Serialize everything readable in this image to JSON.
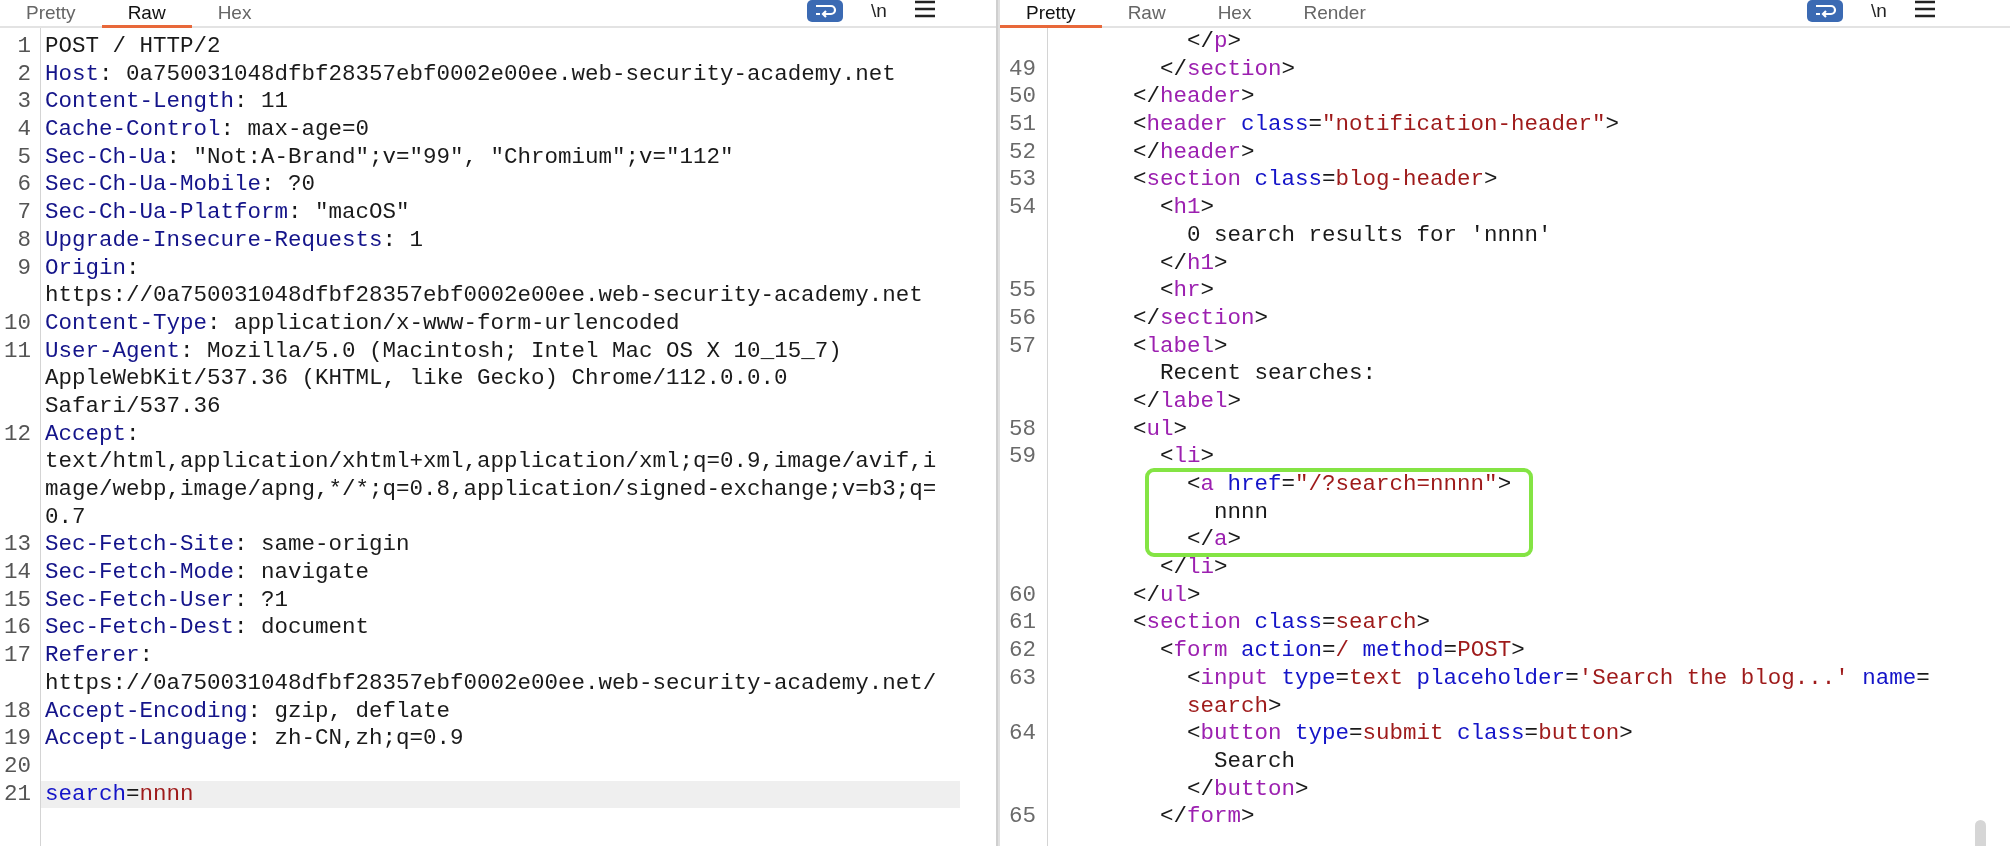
{
  "request_panel": {
    "tabs": [
      {
        "label": "Pretty",
        "selected": false
      },
      {
        "label": "Raw",
        "selected": true
      },
      {
        "label": "Hex",
        "selected": false
      }
    ],
    "newline_toggle": "\\n",
    "rows": [
      {
        "number": "1",
        "current": false,
        "tokens": [
          {
            "kind": "plain",
            "text": "POST / HTTP/2"
          }
        ]
      },
      {
        "number": "2",
        "current": false,
        "tokens": [
          {
            "kind": "name",
            "text": "Host"
          },
          {
            "kind": "plain",
            "text": ": 0a750031048dfbf28357ebf0002e00ee.web-security-academy.net"
          }
        ]
      },
      {
        "number": "3",
        "current": false,
        "tokens": [
          {
            "kind": "name",
            "text": "Content-Length"
          },
          {
            "kind": "plain",
            "text": ": 11"
          }
        ]
      },
      {
        "number": "4",
        "current": false,
        "tokens": [
          {
            "kind": "name",
            "text": "Cache-Control"
          },
          {
            "kind": "plain",
            "text": ": max-age=0"
          }
        ]
      },
      {
        "number": "5",
        "current": false,
        "tokens": [
          {
            "kind": "name",
            "text": "Sec-Ch-Ua"
          },
          {
            "kind": "plain",
            "text": ": \"Not:A-Brand\";v=\"99\", \"Chromium\";v=\"112\""
          }
        ]
      },
      {
        "number": "6",
        "current": false,
        "tokens": [
          {
            "kind": "name",
            "text": "Sec-Ch-Ua-Mobile"
          },
          {
            "kind": "plain",
            "text": ": ?0"
          }
        ]
      },
      {
        "number": "7",
        "current": false,
        "tokens": [
          {
            "kind": "name",
            "text": "Sec-Ch-Ua-Platform"
          },
          {
            "kind": "plain",
            "text": ": \"macOS\""
          }
        ]
      },
      {
        "number": "8",
        "current": false,
        "tokens": [
          {
            "kind": "name",
            "text": "Upgrade-Insecure-Requests"
          },
          {
            "kind": "plain",
            "text": ": 1"
          }
        ]
      },
      {
        "number": "9",
        "current": false,
        "tokens": [
          {
            "kind": "name",
            "text": "Origin"
          },
          {
            "kind": "plain",
            "text": ":"
          }
        ]
      },
      {
        "current": false,
        "tokens": [
          {
            "kind": "plain",
            "text": "https://0a750031048dfbf28357ebf0002e00ee.web-security-academy.net"
          }
        ]
      },
      {
        "number": "10",
        "current": false,
        "tokens": [
          {
            "kind": "name",
            "text": "Content-Type"
          },
          {
            "kind": "plain",
            "text": ": application/x-www-form-urlencoded"
          }
        ]
      },
      {
        "number": "11",
        "current": false,
        "tokens": [
          {
            "kind": "name",
            "text": "User-Agent"
          },
          {
            "kind": "plain",
            "text": ": Mozilla/5.0 (Macintosh; Intel Mac OS X 10_15_7)"
          }
        ]
      },
      {
        "current": false,
        "tokens": [
          {
            "kind": "plain",
            "text": "AppleWebKit/537.36 (KHTML, like Gecko) Chrome/112.0.0.0"
          }
        ]
      },
      {
        "current": false,
        "tokens": [
          {
            "kind": "plain",
            "text": "Safari/537.36"
          }
        ]
      },
      {
        "number": "12",
        "current": false,
        "tokens": [
          {
            "kind": "name",
            "text": "Accept"
          },
          {
            "kind": "plain",
            "text": ":"
          }
        ]
      },
      {
        "current": false,
        "tokens": [
          {
            "kind": "plain",
            "text": "text/html,application/xhtml+xml,application/xml;q=0.9,image/avif,i"
          }
        ]
      },
      {
        "current": false,
        "tokens": [
          {
            "kind": "plain",
            "text": "mage/webp,image/apng,*/*;q=0.8,application/signed-exchange;v=b3;q="
          }
        ]
      },
      {
        "current": false,
        "tokens": [
          {
            "kind": "plain",
            "text": "0.7"
          }
        ]
      },
      {
        "number": "13",
        "current": false,
        "tokens": [
          {
            "kind": "name",
            "text": "Sec-Fetch-Site"
          },
          {
            "kind": "plain",
            "text": ": same-origin"
          }
        ]
      },
      {
        "number": "14",
        "current": false,
        "tokens": [
          {
            "kind": "name",
            "text": "Sec-Fetch-Mode"
          },
          {
            "kind": "plain",
            "text": ": navigate"
          }
        ]
      },
      {
        "number": "15",
        "current": false,
        "tokens": [
          {
            "kind": "name",
            "text": "Sec-Fetch-User"
          },
          {
            "kind": "plain",
            "text": ": ?1"
          }
        ]
      },
      {
        "number": "16",
        "current": false,
        "tokens": [
          {
            "kind": "name",
            "text": "Sec-Fetch-Dest"
          },
          {
            "kind": "plain",
            "text": ": document"
          }
        ]
      },
      {
        "number": "17",
        "current": false,
        "tokens": [
          {
            "kind": "name",
            "text": "Referer"
          },
          {
            "kind": "plain",
            "text": ":"
          }
        ]
      },
      {
        "current": false,
        "tokens": [
          {
            "kind": "plain",
            "text": "https://0a750031048dfbf28357ebf0002e00ee.web-security-academy.net/"
          }
        ]
      },
      {
        "number": "18",
        "current": false,
        "tokens": [
          {
            "kind": "name",
            "text": "Accept-Encoding"
          },
          {
            "kind": "plain",
            "text": ": gzip, deflate"
          }
        ]
      },
      {
        "number": "19",
        "current": false,
        "tokens": [
          {
            "kind": "name",
            "text": "Accept-Language"
          },
          {
            "kind": "plain",
            "text": ": zh-CN,zh;q=0.9"
          }
        ]
      },
      {
        "number": "20",
        "current": false
      },
      {
        "number": "21",
        "current": true,
        "tokens": [
          {
            "kind": "attr",
            "text": "search"
          },
          {
            "kind": "plain",
            "text": "="
          },
          {
            "kind": "value",
            "text": "nnnn"
          }
        ]
      }
    ]
  },
  "response_panel": {
    "tabs": [
      {
        "label": "Pretty",
        "selected": true
      },
      {
        "label": "Raw",
        "selected": false
      },
      {
        "label": "Hex",
        "selected": false
      },
      {
        "label": "Render",
        "selected": false
      }
    ],
    "newline_toggle": "\\n",
    "rows": [
      {
        "boxed": false,
        "tokens": [
          {
            "kind": "plain",
            "text": "          </"
          },
          {
            "kind": "tag",
            "text": "p"
          },
          {
            "kind": "plain",
            "text": ">"
          }
        ]
      },
      {
        "number": "49",
        "boxed": false,
        "tokens": [
          {
            "kind": "plain",
            "text": "        </"
          },
          {
            "kind": "tag",
            "text": "section"
          },
          {
            "kind": "plain",
            "text": ">"
          }
        ]
      },
      {
        "number": "50",
        "boxed": false,
        "tokens": [
          {
            "kind": "plain",
            "text": "      </"
          },
          {
            "kind": "tag",
            "text": "header"
          },
          {
            "kind": "plain",
            "text": ">"
          }
        ]
      },
      {
        "number": "51",
        "boxed": false,
        "tokens": [
          {
            "kind": "plain",
            "text": "      <"
          },
          {
            "kind": "tag",
            "text": "header"
          },
          {
            "kind": "attr",
            "text": " class"
          },
          {
            "kind": "plain",
            "text": "="
          },
          {
            "kind": "value",
            "text": "\"notification-header\""
          },
          {
            "kind": "plain",
            "text": ">"
          }
        ]
      },
      {
        "number": "52",
        "boxed": false,
        "tokens": [
          {
            "kind": "plain",
            "text": "      </"
          },
          {
            "kind": "tag",
            "text": "header"
          },
          {
            "kind": "plain",
            "text": ">"
          }
        ]
      },
      {
        "number": "53",
        "boxed": false,
        "tokens": [
          {
            "kind": "plain",
            "text": "      <"
          },
          {
            "kind": "tag",
            "text": "section"
          },
          {
            "kind": "attr",
            "text": " class"
          },
          {
            "kind": "plain",
            "text": "="
          },
          {
            "kind": "value",
            "text": "blog-header"
          },
          {
            "kind": "plain",
            "text": ">"
          }
        ]
      },
      {
        "number": "54",
        "boxed": false,
        "tokens": [
          {
            "kind": "plain",
            "text": "        <"
          },
          {
            "kind": "tag",
            "text": "h1"
          },
          {
            "kind": "plain",
            "text": ">"
          }
        ]
      },
      {
        "boxed": false,
        "tokens": [
          {
            "kind": "plain",
            "text": "          0 search results for 'nnnn'"
          }
        ]
      },
      {
        "boxed": false,
        "tokens": [
          {
            "kind": "plain",
            "text": "        </"
          },
          {
            "kind": "tag",
            "text": "h1"
          },
          {
            "kind": "plain",
            "text": ">"
          }
        ]
      },
      {
        "number": "55",
        "boxed": false,
        "tokens": [
          {
            "kind": "plain",
            "text": "        <"
          },
          {
            "kind": "tag",
            "text": "hr"
          },
          {
            "kind": "plain",
            "text": ">"
          }
        ]
      },
      {
        "number": "56",
        "boxed": false,
        "tokens": [
          {
            "kind": "plain",
            "text": "      </"
          },
          {
            "kind": "tag",
            "text": "section"
          },
          {
            "kind": "plain",
            "text": ">"
          }
        ]
      },
      {
        "number": "57",
        "boxed": false,
        "tokens": [
          {
            "kind": "plain",
            "text": "      <"
          },
          {
            "kind": "tag",
            "text": "label"
          },
          {
            "kind": "plain",
            "text": ">"
          }
        ]
      },
      {
        "boxed": false,
        "tokens": [
          {
            "kind": "plain",
            "text": "        Recent searches:"
          }
        ]
      },
      {
        "boxed": false,
        "tokens": [
          {
            "kind": "plain",
            "text": "      </"
          },
          {
            "kind": "tag",
            "text": "label"
          },
          {
            "kind": "plain",
            "text": ">"
          }
        ]
      },
      {
        "number": "58",
        "boxed": false,
        "tokens": [
          {
            "kind": "plain",
            "text": "      <"
          },
          {
            "kind": "tag",
            "text": "ul"
          },
          {
            "kind": "plain",
            "text": ">"
          }
        ]
      },
      {
        "number": "59",
        "boxed": false,
        "tokens": [
          {
            "kind": "plain",
            "text": "        <"
          },
          {
            "kind": "tag",
            "text": "li"
          },
          {
            "kind": "plain",
            "text": ">"
          }
        ]
      },
      {
        "boxed": true,
        "tokens": [
          {
            "kind": "plain",
            "text": "          <"
          },
          {
            "kind": "tag",
            "text": "a"
          },
          {
            "kind": "attr",
            "text": " href"
          },
          {
            "kind": "plain",
            "text": "="
          },
          {
            "kind": "value",
            "text": "\"/?search=nnnn\""
          },
          {
            "kind": "plain",
            "text": ">"
          }
        ]
      },
      {
        "boxed": true,
        "tokens": [
          {
            "kind": "plain",
            "text": "            nnnn"
          }
        ]
      },
      {
        "boxed": true,
        "tokens": [
          {
            "kind": "plain",
            "text": "          </"
          },
          {
            "kind": "tag",
            "text": "a"
          },
          {
            "kind": "plain",
            "text": ">"
          }
        ]
      },
      {
        "boxed": false,
        "tokens": [
          {
            "kind": "plain",
            "text": "        </"
          },
          {
            "kind": "tag",
            "text": "li"
          },
          {
            "kind": "plain",
            "text": ">"
          }
        ]
      },
      {
        "number": "60",
        "boxed": false,
        "tokens": [
          {
            "kind": "plain",
            "text": "      </"
          },
          {
            "kind": "tag",
            "text": "ul"
          },
          {
            "kind": "plain",
            "text": ">"
          }
        ]
      },
      {
        "number": "61",
        "boxed": false,
        "tokens": [
          {
            "kind": "plain",
            "text": "      <"
          },
          {
            "kind": "tag",
            "text": "section"
          },
          {
            "kind": "attr",
            "text": " class"
          },
          {
            "kind": "plain",
            "text": "="
          },
          {
            "kind": "value",
            "text": "search"
          },
          {
            "kind": "plain",
            "text": ">"
          }
        ]
      },
      {
        "number": "62",
        "boxed": false,
        "tokens": [
          {
            "kind": "plain",
            "text": "        <"
          },
          {
            "kind": "tag",
            "text": "form"
          },
          {
            "kind": "attr",
            "text": " action"
          },
          {
            "kind": "plain",
            "text": "="
          },
          {
            "kind": "value",
            "text": "/"
          },
          {
            "kind": "attr",
            "text": " method"
          },
          {
            "kind": "plain",
            "text": "="
          },
          {
            "kind": "value",
            "text": "POST"
          },
          {
            "kind": "plain",
            "text": ">"
          }
        ]
      },
      {
        "number": "63",
        "boxed": false,
        "tokens": [
          {
            "kind": "plain",
            "text": "          <"
          },
          {
            "kind": "tag",
            "text": "input"
          },
          {
            "kind": "attr",
            "text": " type"
          },
          {
            "kind": "plain",
            "text": "="
          },
          {
            "kind": "value",
            "text": "text"
          },
          {
            "kind": "attr",
            "text": " placeholder"
          },
          {
            "kind": "plain",
            "text": "="
          },
          {
            "kind": "value",
            "text": "'Search the blog...'"
          },
          {
            "kind": "attr",
            "text": " name"
          },
          {
            "kind": "plain",
            "text": "="
          }
        ]
      },
      {
        "boxed": false,
        "tokens": [
          {
            "kind": "value",
            "text": "          search"
          },
          {
            "kind": "plain",
            "text": ">"
          }
        ]
      },
      {
        "number": "64",
        "boxed": false,
        "tokens": [
          {
            "kind": "plain",
            "text": "          <"
          },
          {
            "kind": "tag",
            "text": "button"
          },
          {
            "kind": "attr",
            "text": " type"
          },
          {
            "kind": "plain",
            "text": "="
          },
          {
            "kind": "value",
            "text": "submit"
          },
          {
            "kind": "attr",
            "text": " class"
          },
          {
            "kind": "plain",
            "text": "="
          },
          {
            "kind": "value",
            "text": "button"
          },
          {
            "kind": "plain",
            "text": ">"
          }
        ]
      },
      {
        "boxed": false,
        "tokens": [
          {
            "kind": "plain",
            "text": "            Search"
          }
        ]
      },
      {
        "boxed": false,
        "tokens": [
          {
            "kind": "plain",
            "text": "          </"
          },
          {
            "kind": "tag",
            "text": "button"
          },
          {
            "kind": "plain",
            "text": ">"
          }
        ]
      },
      {
        "number": "65",
        "boxed": false,
        "tokens": [
          {
            "kind": "plain",
            "text": "        </"
          },
          {
            "kind": "tag",
            "text": "form"
          },
          {
            "kind": "plain",
            "text": ">"
          }
        ]
      }
    ]
  }
}
